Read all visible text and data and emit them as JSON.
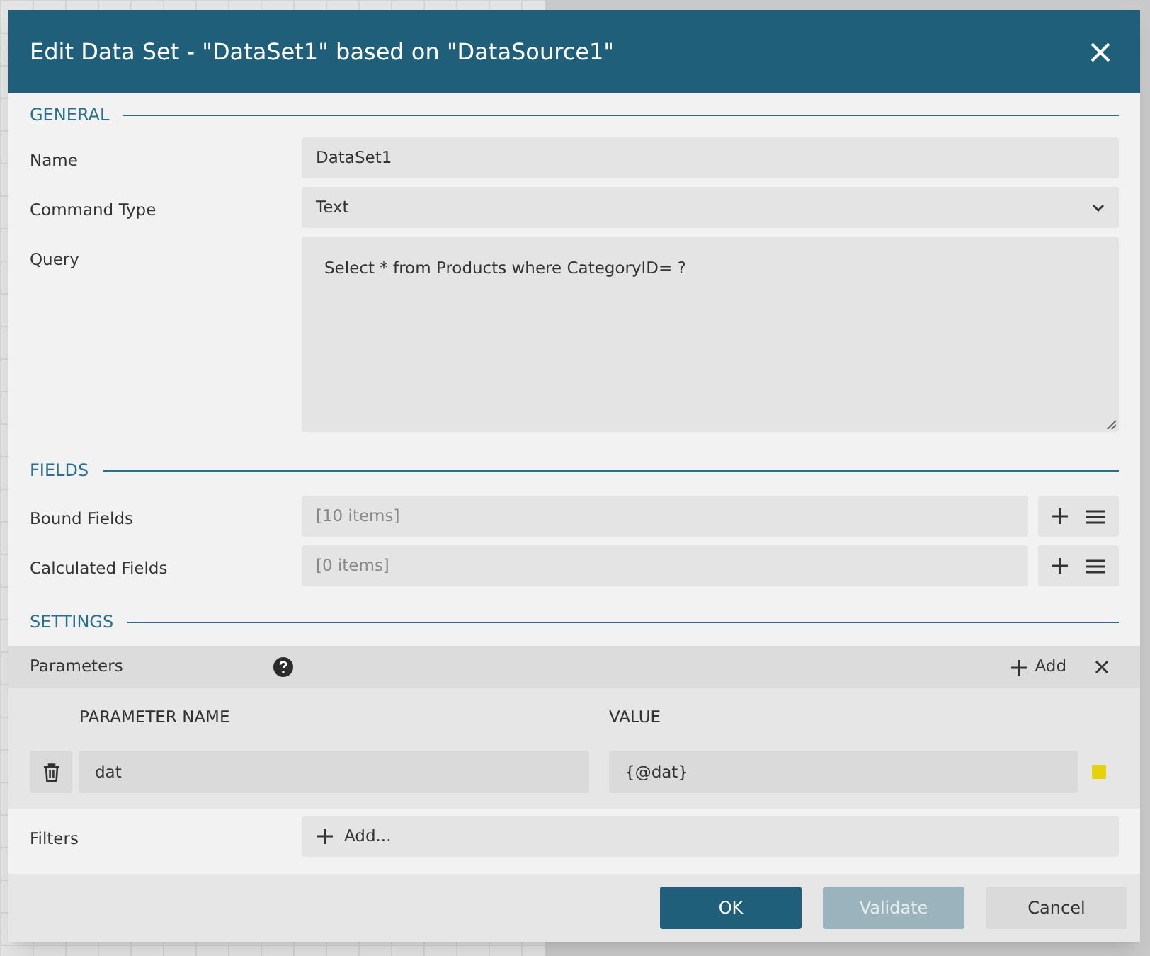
{
  "window": {
    "title": "Edit Data Set - \"DataSet1\" based on \"DataSource1\""
  },
  "general": {
    "heading": "GENERAL",
    "name": {
      "label": "Name",
      "value": "DataSet1"
    },
    "command_type": {
      "label": "Command Type",
      "value": "Text"
    },
    "query": {
      "label": "Query",
      "value": "Select * from Products where CategoryID= ?"
    }
  },
  "fields": {
    "heading": "FIELDS",
    "rows": [
      {
        "label": "Bound Fields",
        "value": "[10 items]"
      },
      {
        "label": "Calculated Fields",
        "value": "[0 items]"
      }
    ]
  },
  "settings": {
    "heading": "SETTINGS",
    "parameters": {
      "label": "Parameters",
      "add": "Add",
      "columns": [
        "PARAMETER NAME",
        "VALUE"
      ],
      "rows": [
        {
          "name": "dat",
          "value": "{@dat}",
          "color": "#e6d20a"
        }
      ]
    },
    "filters": {
      "label": "Filters",
      "add": "Add..."
    }
  },
  "buttons": [
    {
      "label": "OK",
      "kind": "primary",
      "disabled": false
    },
    {
      "label": "Validate",
      "kind": "primary",
      "disabled": true
    },
    {
      "label": "Cancel",
      "kind": "secondary",
      "disabled": false
    }
  ]
}
